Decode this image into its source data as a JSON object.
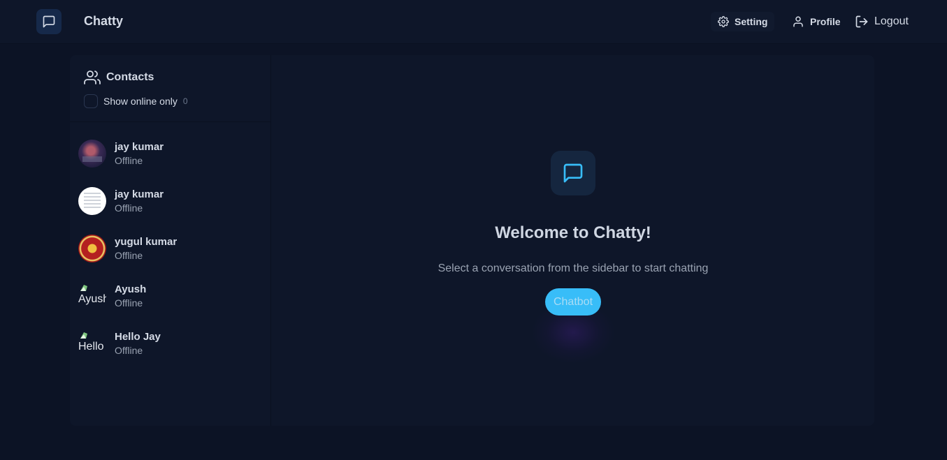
{
  "header": {
    "app_title": "Chatty",
    "logo_icon": "message-square-icon",
    "setting_label": "Setting",
    "profile_label": "Profile",
    "logout_label": "Logout"
  },
  "sidebar": {
    "title": "Contacts",
    "filter_label": "Show online only",
    "online_count": "0",
    "contacts": [
      {
        "name": "jay kumar",
        "status": "Offline"
      },
      {
        "name": "jay kumar",
        "status": "Offline"
      },
      {
        "name": "yugul kumar",
        "status": "Offline"
      },
      {
        "name": "Ayush",
        "status": "Offline",
        "avatar_alt": "Ayush"
      },
      {
        "name": "Hello Jay",
        "status": "Offline",
        "avatar_alt": "Hello Jay"
      }
    ]
  },
  "welcome": {
    "title": "Welcome to Chatty!",
    "subtitle": "Select a conversation from the sidebar to start chatting",
    "chatbot_label": "Chatbot"
  },
  "colors": {
    "background": "#0c1325",
    "panel": "#0e1629",
    "accent": "#38bdf8"
  }
}
